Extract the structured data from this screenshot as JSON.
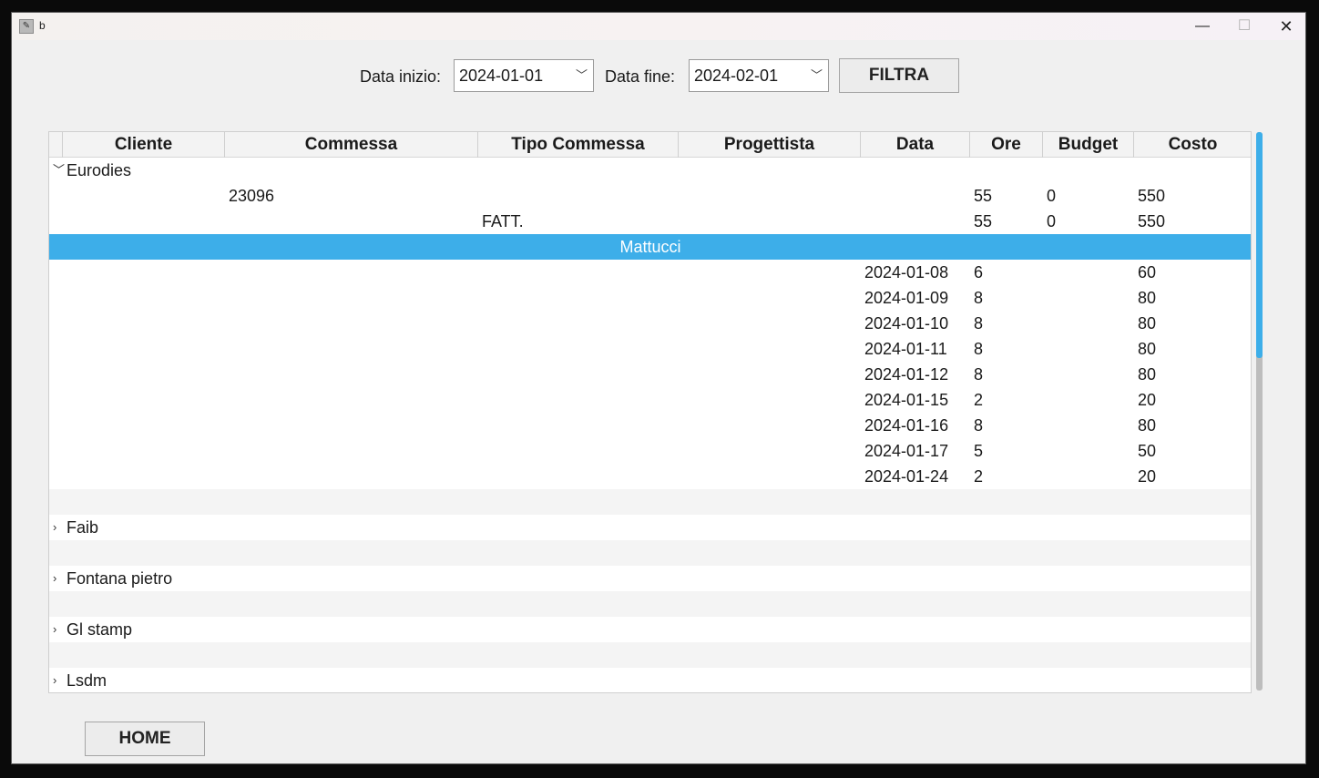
{
  "window": {
    "title": "b",
    "app_icon": "feather-icon",
    "controls": [
      "minimize-icon",
      "maximize-icon",
      "close-icon"
    ]
  },
  "filter": {
    "start_label": "Data inizio:",
    "start_value": "2024-01-01",
    "end_label": "Data fine:",
    "end_value": "2024-02-01",
    "filter_button": "FILTRA"
  },
  "table": {
    "columns": [
      "Cliente",
      "Commessa",
      "Tipo Commessa",
      "Progettista",
      "Data",
      "Ore",
      "Budget",
      "Costo"
    ],
    "clients": [
      {
        "name": "Eurodies",
        "expanded": true
      },
      {
        "name": "Faib",
        "expanded": false
      },
      {
        "name": "Fontana pietro",
        "expanded": false
      },
      {
        "name": "Gl stamp",
        "expanded": false
      },
      {
        "name": "Lsdm",
        "expanded": false
      }
    ],
    "commessa_row": {
      "commessa": "23096",
      "ore": "55",
      "budget": "0",
      "costo": "550"
    },
    "tipo_row": {
      "tipo": "FATT.",
      "ore": "55",
      "budget": "0",
      "costo": "550"
    },
    "selected_row": {
      "progettista": "Mattucci"
    },
    "detail_rows": [
      {
        "data": "2024-01-08",
        "ore": "6",
        "costo": "60"
      },
      {
        "data": "2024-01-09",
        "ore": "8",
        "costo": "80"
      },
      {
        "data": "2024-01-10",
        "ore": "8",
        "costo": "80"
      },
      {
        "data": "2024-01-11",
        "ore": "8",
        "costo": "80"
      },
      {
        "data": "2024-01-12",
        "ore": "8",
        "costo": "80"
      },
      {
        "data": "2024-01-15",
        "ore": "2",
        "costo": "20"
      },
      {
        "data": "2024-01-16",
        "ore": "8",
        "costo": "80"
      },
      {
        "data": "2024-01-17",
        "ore": "5",
        "costo": "50"
      },
      {
        "data": "2024-01-24",
        "ore": "2",
        "costo": "20"
      }
    ],
    "selection_color": "#3daee9"
  },
  "footer": {
    "home_button": "HOME"
  }
}
